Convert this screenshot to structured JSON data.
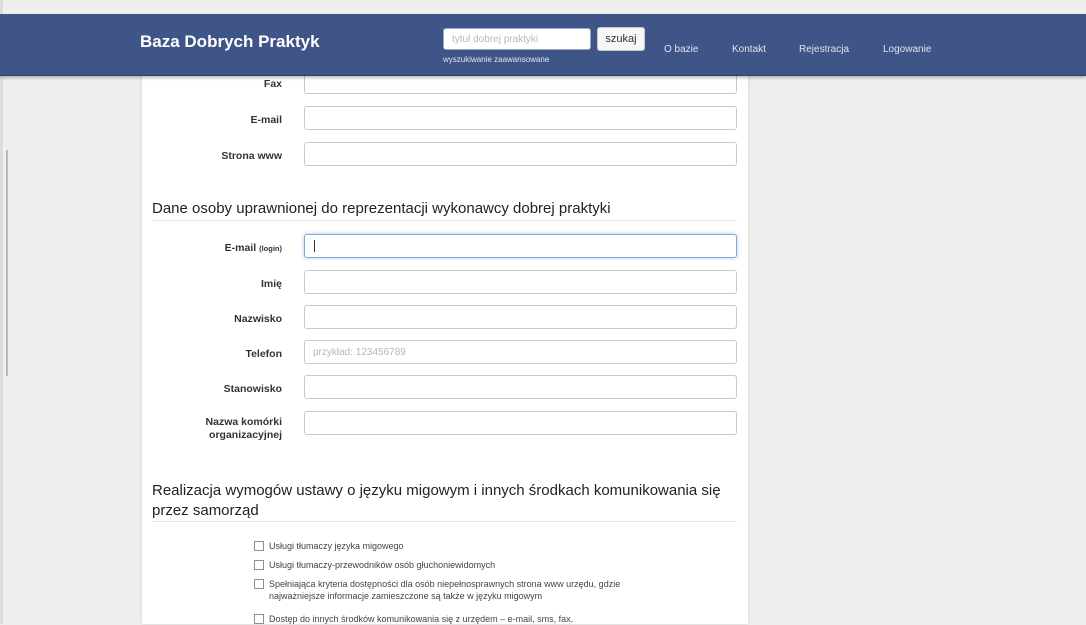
{
  "header": {
    "brand": "Baza Dobrych Praktyk",
    "search_placeholder": "tytuł dobrej praktyki",
    "search_button": "szukaj",
    "advanced_search": "wyszukiwanie zaawansowane",
    "nav": [
      "O bazie",
      "Kontakt",
      "Rejestracja",
      "Logowanie"
    ],
    "bar_color": "#3f5487"
  },
  "contact_fields": [
    {
      "label": "Fax",
      "value": ""
    },
    {
      "label": "E-mail",
      "value": ""
    },
    {
      "label": "Strona www",
      "value": ""
    }
  ],
  "representative": {
    "heading": "Dane osoby uprawnionej do reprezentacji wykonawcy dobrej praktyki",
    "email_label": "E-mail",
    "email_label_suffix": "(login)",
    "first_name_label": "Imię",
    "last_name_label": "Nazwisko",
    "phone_label": "Telefon",
    "phone_placeholder": "przykład: 123456789",
    "position_label": "Stanowisko",
    "unit_label_line1": "Nazwa komórki",
    "unit_label_line2": "organizacyjnej"
  },
  "sign_language": {
    "heading_line1": "Realizacja wymogów ustawy o języku migowym i innych środkach komunikowania się",
    "heading_line2": "przez samorząd",
    "options": [
      {
        "line1": "Usługi tłumaczy języka migowego",
        "line2": "",
        "checked": false
      },
      {
        "line1": "Usługi tłumaczy-przewodników osób głuchoniewidomych",
        "line2": "",
        "checked": false
      },
      {
        "line1": "Spełniająca kryteria dostępności dla osób niepełnosprawnych strona www urzędu, gdzie",
        "line2": "najważniejsze informacje zamieszczone są także w języku migowym",
        "checked": false
      },
      {
        "line1": "Dostęp do innych środków komunikowania się z urzędem – e-mail, sms, fax.",
        "line2": "",
        "checked": false
      }
    ]
  }
}
